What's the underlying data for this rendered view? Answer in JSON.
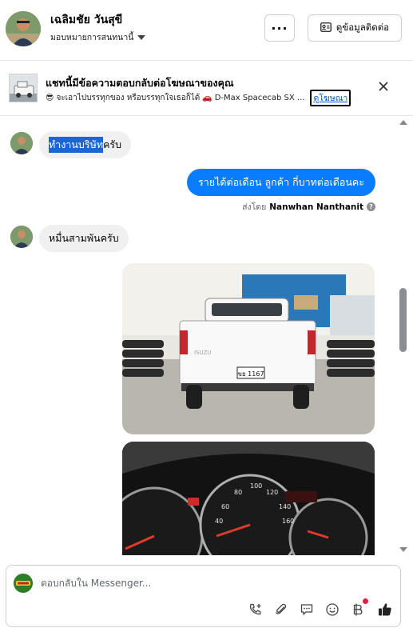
{
  "header": {
    "contact_name": "เฉลิมชัย วันสุขี",
    "assign_label": "มอบหมายการสนทนานี้",
    "more_label": "···",
    "contact_info_label": "ดูข้อมูลติดต่อ"
  },
  "ad_banner": {
    "title": "แชทนี้มีข้อความตอบกลับต่อโฆษณาของคุณ",
    "subtitle_emoji": "😎",
    "subtitle_text": "จะเอาไปบรรทุกของ หรือบรรทุกใจเธอก็ได้",
    "car_emoji": "🚗",
    "ad_name": "D-Max Spacecab SX ...",
    "view_ad_label": "ดูโฆษณา"
  },
  "messages": [
    {
      "direction": "in",
      "text_selected": "ทำงานบริษัท",
      "text_rest": "ครับ"
    },
    {
      "direction": "out",
      "text": "รายได้ต่อเดือน ลูกค้า  กี่บาทต่อเดือนคะ",
      "sent_by_prefix": "ส่งโดย",
      "sent_by_name": "Nanwhan Nanthanit"
    },
    {
      "direction": "in",
      "text": "หมื่นสามพันครับ"
    },
    {
      "direction": "in",
      "type": "photo",
      "plate": "ขย 1167",
      "brand": "ISUZU"
    },
    {
      "direction": "in",
      "type": "photo",
      "subject": "dashboard"
    }
  ],
  "composer": {
    "placeholder": "ตอบกลับใน Messenger..."
  },
  "icons": {
    "call": "phone-plus-icon",
    "attach": "paperclip-icon",
    "saved_replies": "chat-bubble-icon",
    "emoji": "smiley-icon",
    "payment": "baht-icon",
    "like": "thumbs-up-icon"
  },
  "colors": {
    "accent": "#0a7cff",
    "incoming_bubble": "#f0f0f0",
    "selection": "#1a66d6",
    "badge": "#e41e3f"
  }
}
